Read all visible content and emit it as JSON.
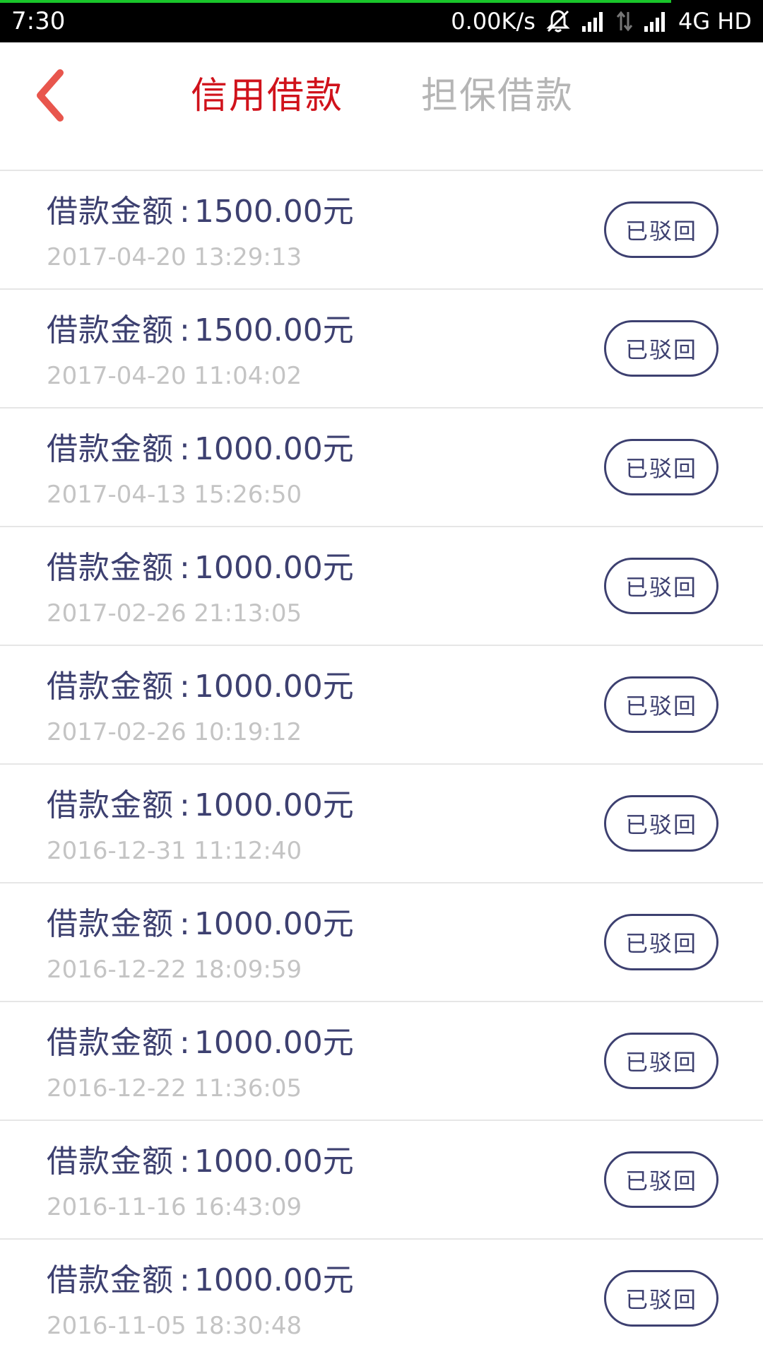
{
  "status_bar": {
    "time": "7:30",
    "network_speed": "0.00K/s",
    "network_type": "4G HD",
    "icons": [
      "notification-muted-icon",
      "signal-icon",
      "data-transfer-icon",
      "signal-icon"
    ],
    "progress_color": "#19c52a"
  },
  "header": {
    "back_icon": "chevron-left-icon",
    "tabs": [
      {
        "label": "信用借款",
        "active": true
      },
      {
        "label": "担保借款",
        "active": false
      }
    ],
    "active_color": "#d0121b",
    "inactive_color": "#b5b5b5"
  },
  "loans": {
    "amount_label": "借款金额",
    "colon": ":",
    "items": [
      {
        "amount": "1500.00元",
        "date": "2017-04-20 13:29:13",
        "status": "已驳回"
      },
      {
        "amount": "1500.00元",
        "date": "2017-04-20 11:04:02",
        "status": "已驳回"
      },
      {
        "amount": "1000.00元",
        "date": "2017-04-13 15:26:50",
        "status": "已驳回"
      },
      {
        "amount": "1000.00元",
        "date": "2017-02-26 21:13:05",
        "status": "已驳回"
      },
      {
        "amount": "1000.00元",
        "date": "2017-02-26 10:19:12",
        "status": "已驳回"
      },
      {
        "amount": "1000.00元",
        "date": "2016-12-31 11:12:40",
        "status": "已驳回"
      },
      {
        "amount": "1000.00元",
        "date": "2016-12-22 18:09:59",
        "status": "已驳回"
      },
      {
        "amount": "1000.00元",
        "date": "2016-12-22 11:36:05",
        "status": "已驳回"
      },
      {
        "amount": "1000.00元",
        "date": "2016-11-16 16:43:09",
        "status": "已驳回"
      },
      {
        "amount": "1000.00元",
        "date": "2016-11-05 18:30:48",
        "status": "已驳回"
      }
    ],
    "text_color": "#3d4070",
    "date_color": "#c4c4c4"
  }
}
